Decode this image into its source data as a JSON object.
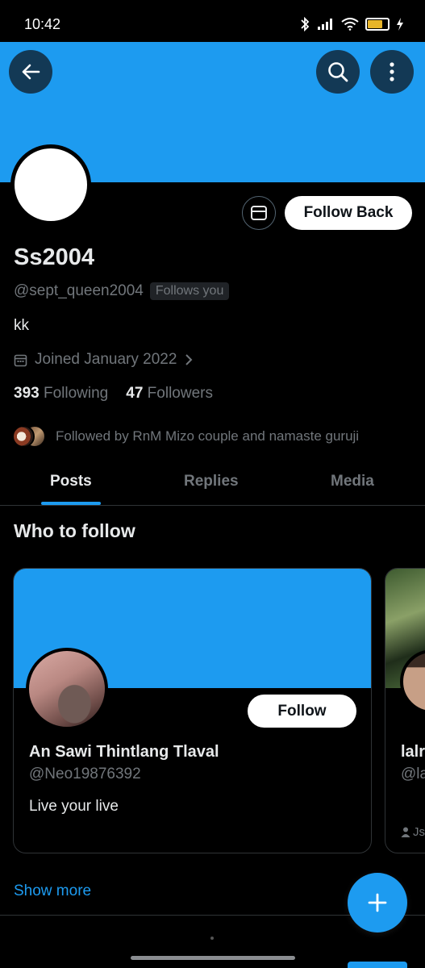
{
  "status_bar": {
    "time": "10:42",
    "battery_level": 0.75,
    "icons": [
      "bluetooth-icon",
      "signal-icon",
      "wifi-icon",
      "battery-icon",
      "charging-icon"
    ]
  },
  "colors": {
    "accent": "#1d9bf0",
    "background": "#000000",
    "text_primary": "#e7e9ea",
    "text_secondary": "#71767b",
    "border": "#2f3336"
  },
  "header": {
    "back_icon": "arrow-left-icon",
    "search_icon": "search-icon",
    "more_icon": "more-vertical-icon"
  },
  "profile": {
    "display_name": "Ss2004",
    "handle": "@sept_queen2004",
    "follows_you_badge": "Follows you",
    "bio": "kk",
    "joined": "Joined January 2022",
    "following_count": "393",
    "following_label": "Following",
    "followers_count": "47",
    "followers_label": "Followers",
    "followed_by": "Followed by RnM Mizo couple and namaste guruji",
    "follow_back_label": "Follow Back",
    "message_icon": "mail-icon"
  },
  "tabs": [
    {
      "label": "Posts",
      "active": true
    },
    {
      "label": "Replies",
      "active": false
    },
    {
      "label": "Media",
      "active": false
    }
  ],
  "who_to_follow": {
    "title": "Who to follow",
    "cards": [
      {
        "name": "An Sawi Thintlang Tlaval",
        "handle": "@Neo19876392",
        "bio": "Live your live",
        "follow_label": "Follow"
      },
      {
        "name": "lalr",
        "handle": "@la",
        "meta": "Js"
      }
    ],
    "show_more": "Show more"
  },
  "fab": {
    "icon": "plus-icon"
  }
}
